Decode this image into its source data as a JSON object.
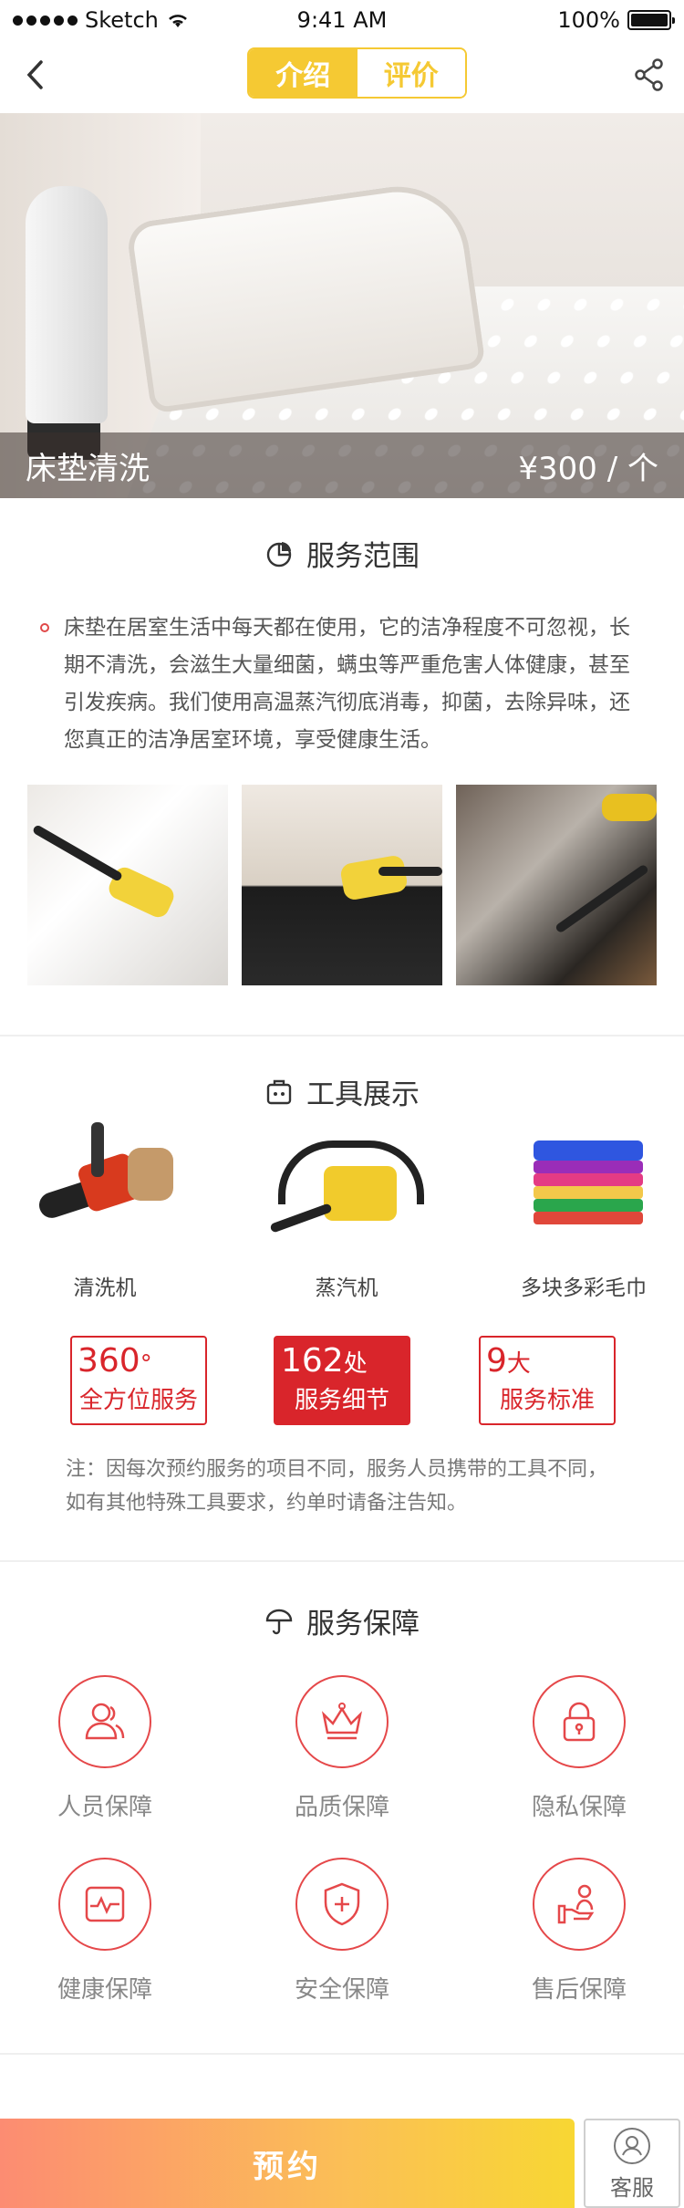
{
  "status_bar": {
    "carrier": "Sketch",
    "time": "9:41 AM",
    "battery": "100%"
  },
  "nav": {
    "tabs": [
      {
        "label": "介绍",
        "active": true
      },
      {
        "label": "评价",
        "active": false
      }
    ]
  },
  "hero": {
    "title": "床垫清洗",
    "price": "¥300 / 个"
  },
  "scope": {
    "title": "服务范围",
    "text": "床垫在居室生活中每天都在使用，它的洁净程度不可忽视，长期不清洗，会滋生大量细菌，螨虫等严重危害人体健康，甚至引发疾病。我们使用高温蒸汽彻底消毒，抑菌，去除异味，还您真正的洁净居室环境，享受健康生活。"
  },
  "tools": {
    "title": "工具展示",
    "items": [
      {
        "label": "清洗机",
        "icon": "rotary-cleaner-image"
      },
      {
        "label": "蒸汽机",
        "icon": "steam-machine-image"
      },
      {
        "label": "多块多彩毛巾",
        "icon": "towel-stack-image"
      }
    ],
    "stats": [
      {
        "num": "360",
        "suffix": "°",
        "text": "全方位服务"
      },
      {
        "num": "162",
        "suffix": "处",
        "text": "服务细节"
      },
      {
        "num": "9",
        "suffix": "大",
        "text": "服务标准"
      }
    ],
    "note": "注：因每次预约服务的项目不同，服务人员携带的工具不同，如有其他特殊工具要求，约单时请备注告知。"
  },
  "guarantee": {
    "title": "服务保障",
    "items": [
      {
        "label": "人员保障",
        "icon": "people-icon"
      },
      {
        "label": "品质保障",
        "icon": "crown-icon"
      },
      {
        "label": "隐私保障",
        "icon": "lock-icon"
      },
      {
        "label": "健康保障",
        "icon": "heartbeat-icon"
      },
      {
        "label": "安全保障",
        "icon": "shield-icon"
      },
      {
        "label": "售后保障",
        "icon": "hand-service-icon"
      }
    ]
  },
  "bottom": {
    "book_label": "预约",
    "service_label": "客服"
  },
  "colors": {
    "accent_yellow": "#f5c933",
    "accent_red": "#d9252b",
    "icon_red": "#e5484a"
  }
}
